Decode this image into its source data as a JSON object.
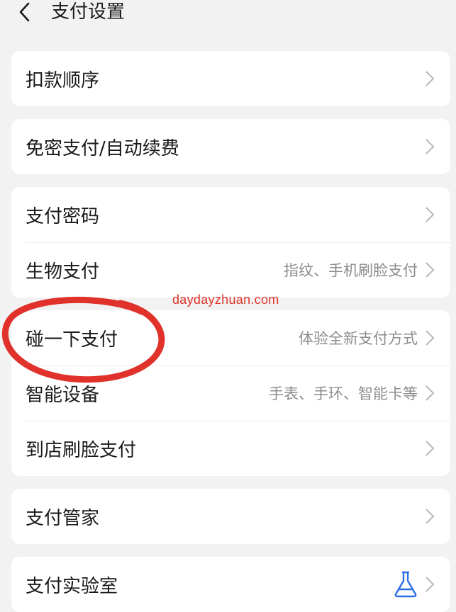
{
  "header": {
    "title": "支付设置"
  },
  "groups": [
    {
      "rows": [
        {
          "label": "扣款顺序",
          "value": ""
        }
      ]
    },
    {
      "rows": [
        {
          "label": "免密支付/自动续费",
          "value": ""
        }
      ]
    },
    {
      "rows": [
        {
          "label": "支付密码",
          "value": ""
        },
        {
          "label": "生物支付",
          "value": "指纹、手机刷脸支付"
        }
      ]
    },
    {
      "rows": [
        {
          "label": "碰一下支付",
          "value": "体验全新支付方式"
        },
        {
          "label": "智能设备",
          "value": "手表、手环、智能卡等"
        },
        {
          "label": "到店刷脸支付",
          "value": ""
        }
      ]
    },
    {
      "rows": [
        {
          "label": "支付管家",
          "value": ""
        }
      ]
    },
    {
      "rows": [
        {
          "label": "支付实验室",
          "value": "",
          "icon": "flask-icon"
        }
      ]
    }
  ],
  "watermark": "daydayzhuan.com",
  "colors": {
    "background": "#f2f2f2",
    "card": "#ffffff",
    "annotation": "#e0322a",
    "flask": "#2b6fe6"
  }
}
